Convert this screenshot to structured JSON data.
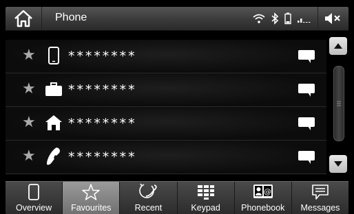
{
  "header": {
    "title": "Phone",
    "home_icon": "home-icon",
    "status_icons": [
      "wifi-icon",
      "bluetooth-icon",
      "battery-icon",
      "signal-icon",
      "mute-icon"
    ]
  },
  "favourites": [
    {
      "type": "mobile",
      "icon": "mobile-phone-icon",
      "number": "********"
    },
    {
      "type": "work",
      "icon": "briefcase-icon",
      "number": "********"
    },
    {
      "type": "home",
      "icon": "house-icon",
      "number": "********"
    },
    {
      "type": "other",
      "icon": "handset-icon",
      "number": "********"
    }
  ],
  "tabs": [
    {
      "label": "Overview",
      "icon": "phone-outline-icon",
      "active": false
    },
    {
      "label": "Favourites",
      "icon": "star-outline-icon",
      "active": true
    },
    {
      "label": "Recent",
      "icon": "recent-calls-icon",
      "active": false
    },
    {
      "label": "Keypad",
      "icon": "keypad-icon",
      "active": false
    },
    {
      "label": "Phonebook",
      "icon": "phonebook-icon",
      "active": false
    },
    {
      "label": "Messages",
      "icon": "messages-icon",
      "active": false
    }
  ],
  "colors": {
    "accent": "#ffffff",
    "active_tab": "#8a8a8a",
    "background": "#000000"
  }
}
